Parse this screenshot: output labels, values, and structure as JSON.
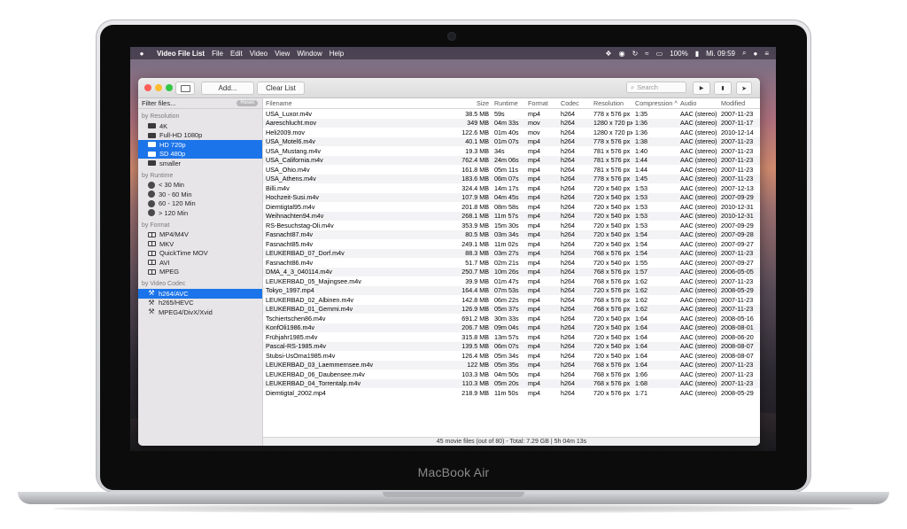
{
  "laptop": {
    "brand": "MacBook Air"
  },
  "menubar": {
    "app_name": "Video File List",
    "menus": [
      "File",
      "Edit",
      "Video",
      "View",
      "Window",
      "Help"
    ],
    "battery": "100%",
    "clock": "Mi. 09:59"
  },
  "toolbar": {
    "add_label": "Add...",
    "clear_label": "Clear List",
    "search_placeholder": "Search"
  },
  "sidebar": {
    "filter_label": "Filter files...",
    "reset_label": "Reset",
    "sections": [
      {
        "title": "by Resolution",
        "icon": "resolution-icon",
        "items": [
          {
            "label": "4K",
            "selected": false
          },
          {
            "label": "Full-HD 1080p",
            "selected": false
          },
          {
            "label": "HD 720p",
            "selected": true
          },
          {
            "label": "SD 480p",
            "selected": true
          },
          {
            "label": "smaller",
            "selected": false
          }
        ]
      },
      {
        "title": "by Runtime",
        "icon": "clock-icon",
        "items": [
          {
            "label": "< 30 Min",
            "selected": false
          },
          {
            "label": "30 - 60 Min",
            "selected": false
          },
          {
            "label": "60 - 120 Min",
            "selected": false
          },
          {
            "label": "> 120 Min",
            "selected": false
          }
        ]
      },
      {
        "title": "by Format",
        "icon": "film-icon",
        "items": [
          {
            "label": "MP4/M4V",
            "selected": false
          },
          {
            "label": "MKV",
            "selected": false
          },
          {
            "label": "QuickTime MOV",
            "selected": false
          },
          {
            "label": "AVI",
            "selected": false
          },
          {
            "label": "MPEG",
            "selected": false
          }
        ]
      },
      {
        "title": "by Video Codec",
        "icon": "wrench-icon",
        "items": [
          {
            "label": "h264/AVC",
            "selected": true
          },
          {
            "label": "h265/HEVC",
            "selected": false
          },
          {
            "label": "MPEG4/DivX/Xvid",
            "selected": false
          }
        ]
      }
    ]
  },
  "table": {
    "columns": [
      "Filename",
      "Size",
      "Runtime",
      "Format",
      "Codec",
      "Resolution",
      "Compression ^",
      "Audio",
      "Modified"
    ],
    "rows": [
      [
        "USA_Luxor.m4v",
        "38.5 MB",
        "59s",
        "mp4",
        "h264",
        "778 x 576 px",
        "1:35",
        "AAC (stereo)",
        "2007-11-23"
      ],
      [
        "Aareschlucht.mov",
        "349 MB",
        "04m 33s",
        "mov",
        "h264",
        "1280 x 720 px",
        "1:36",
        "AAC (stereo)",
        "2007-11-17"
      ],
      [
        "Heli2009.mov",
        "122.6 MB",
        "01m 40s",
        "mov",
        "h264",
        "1280 x 720 px",
        "1:36",
        "AAC (stereo)",
        "2010-12-14"
      ],
      [
        "USA_Motel6.m4v",
        "40.1 MB",
        "01m 07s",
        "mp4",
        "h264",
        "778 x 576 px",
        "1:38",
        "AAC (stereo)",
        "2007-11-23"
      ],
      [
        "USA_Mustang.m4v",
        "19.3 MB",
        "34s",
        "mp4",
        "h264",
        "781 x 576 px",
        "1:40",
        "AAC (stereo)",
        "2007-11-23"
      ],
      [
        "USA_California.m4v",
        "762.4 MB",
        "24m 06s",
        "mp4",
        "h264",
        "781 x 576 px",
        "1:44",
        "AAC (stereo)",
        "2007-11-23"
      ],
      [
        "USA_Ohio.m4v",
        "161.8 MB",
        "05m 11s",
        "mp4",
        "h264",
        "781 x 576 px",
        "1:44",
        "AAC (stereo)",
        "2007-11-23"
      ],
      [
        "USA_Athens.m4v",
        "183.6 MB",
        "06m 07s",
        "mp4",
        "h264",
        "778 x 576 px",
        "1:45",
        "AAC (stereo)",
        "2007-11-23"
      ],
      [
        "Billi.m4v",
        "324.4 MB",
        "14m 17s",
        "mp4",
        "h264",
        "720 x 540 px",
        "1:53",
        "AAC (stereo)",
        "2007-12-13"
      ],
      [
        "Hochzeit-Susi.m4v",
        "107.9 MB",
        "04m 45s",
        "mp4",
        "h264",
        "720 x 540 px",
        "1:53",
        "AAC (stereo)",
        "2007-09-29"
      ],
      [
        "Diemtigtal95.m4v",
        "201.8 MB",
        "08m 58s",
        "mp4",
        "h264",
        "720 x 540 px",
        "1:53",
        "AAC (stereo)",
        "2010-12-31"
      ],
      [
        "Weihnachten94.m4v",
        "268.1 MB",
        "11m 57s",
        "mp4",
        "h264",
        "720 x 540 px",
        "1:53",
        "AAC (stereo)",
        "2010-12-31"
      ],
      [
        "RS-Besuchstag-Oli.m4v",
        "353.9 MB",
        "15m 30s",
        "mp4",
        "h264",
        "720 x 540 px",
        "1:53",
        "AAC (stereo)",
        "2007-09-29"
      ],
      [
        "Fasnacht87.m4v",
        "80.5 MB",
        "03m 34s",
        "mp4",
        "h264",
        "720 x 540 px",
        "1:54",
        "AAC (stereo)",
        "2007-09-28"
      ],
      [
        "Fasnacht85.m4v",
        "249.1 MB",
        "11m 02s",
        "mp4",
        "h264",
        "720 x 540 px",
        "1:54",
        "AAC (stereo)",
        "2007-09-27"
      ],
      [
        "LEUKERBAD_07_Dorf.m4v",
        "88.3 MB",
        "03m 27s",
        "mp4",
        "h264",
        "768 x 576 px",
        "1:54",
        "AAC (stereo)",
        "2007-11-23"
      ],
      [
        "Fasnacht86.m4v",
        "51.7 MB",
        "02m 21s",
        "mp4",
        "h264",
        "720 x 540 px",
        "1:55",
        "AAC (stereo)",
        "2007-09-27"
      ],
      [
        "DMA_4_3_040114.m4v",
        "250.7 MB",
        "10m 26s",
        "mp4",
        "h264",
        "768 x 576 px",
        "1:57",
        "AAC (stereo)",
        "2006-05-05"
      ],
      [
        "LEUKERBAD_05_Majingsee.m4v",
        "39.9 MB",
        "01m 47s",
        "mp4",
        "h264",
        "768 x 576 px",
        "1:62",
        "AAC (stereo)",
        "2007-11-23"
      ],
      [
        "Tokyo_1997.mp4",
        "164.4 MB",
        "07m 53s",
        "mp4",
        "h264",
        "720 x 576 px",
        "1:62",
        "AAC (stereo)",
        "2008-05-29"
      ],
      [
        "LEUKERBAD_02_Albinen.m4v",
        "142.8 MB",
        "06m 22s",
        "mp4",
        "h264",
        "768 x 576 px",
        "1:62",
        "AAC (stereo)",
        "2007-11-23"
      ],
      [
        "LEUKERBAD_01_Gemmi.m4v",
        "126.9 MB",
        "05m 37s",
        "mp4",
        "h264",
        "768 x 576 px",
        "1:62",
        "AAC (stereo)",
        "2007-11-23"
      ],
      [
        "Tschiertschen86.m4v",
        "691.2 MB",
        "30m 33s",
        "mp4",
        "h264",
        "720 x 540 px",
        "1:64",
        "AAC (stereo)",
        "2008-05-16"
      ],
      [
        "KonfOli1986.m4v",
        "206.7 MB",
        "09m 04s",
        "mp4",
        "h264",
        "720 x 540 px",
        "1:64",
        "AAC (stereo)",
        "2008-08-01"
      ],
      [
        "Frühjahr1985.m4v",
        "315.8 MB",
        "13m 57s",
        "mp4",
        "h264",
        "720 x 540 px",
        "1:64",
        "AAC (stereo)",
        "2008-06-20"
      ],
      [
        "Pascal-RS-1985.m4v",
        "139.5 MB",
        "06m 07s",
        "mp4",
        "h264",
        "720 x 540 px",
        "1:64",
        "AAC (stereo)",
        "2008-08-07"
      ],
      [
        "Stubsi-UsOma1985.m4v",
        "126.4 MB",
        "05m 34s",
        "mp4",
        "h264",
        "720 x 540 px",
        "1:64",
        "AAC (stereo)",
        "2008-08-07"
      ],
      [
        "LEUKERBAD_03_Laemmernsee.m4v",
        "122 MB",
        "05m 35s",
        "mp4",
        "h264",
        "768 x 576 px",
        "1:64",
        "AAC (stereo)",
        "2007-11-23"
      ],
      [
        "LEUKERBAD_06_Daubensee.m4v",
        "103.3 MB",
        "04m 50s",
        "mp4",
        "h264",
        "768 x 576 px",
        "1:66",
        "AAC (stereo)",
        "2007-11-23"
      ],
      [
        "LEUKERBAD_04_Torrentalp.m4v",
        "110.3 MB",
        "05m 20s",
        "mp4",
        "h264",
        "768 x 576 px",
        "1:68",
        "AAC (stereo)",
        "2007-11-23"
      ],
      [
        "Diemtigtal_2002.mp4",
        "218.9 MB",
        "11m 50s",
        "mp4",
        "h264",
        "720 x 576 px",
        "1:71",
        "AAC (stereo)",
        "2008-05-29"
      ]
    ],
    "status": "45 movie files (out of 80) - Total: 7.29 GB | 5h 04m 13s"
  }
}
